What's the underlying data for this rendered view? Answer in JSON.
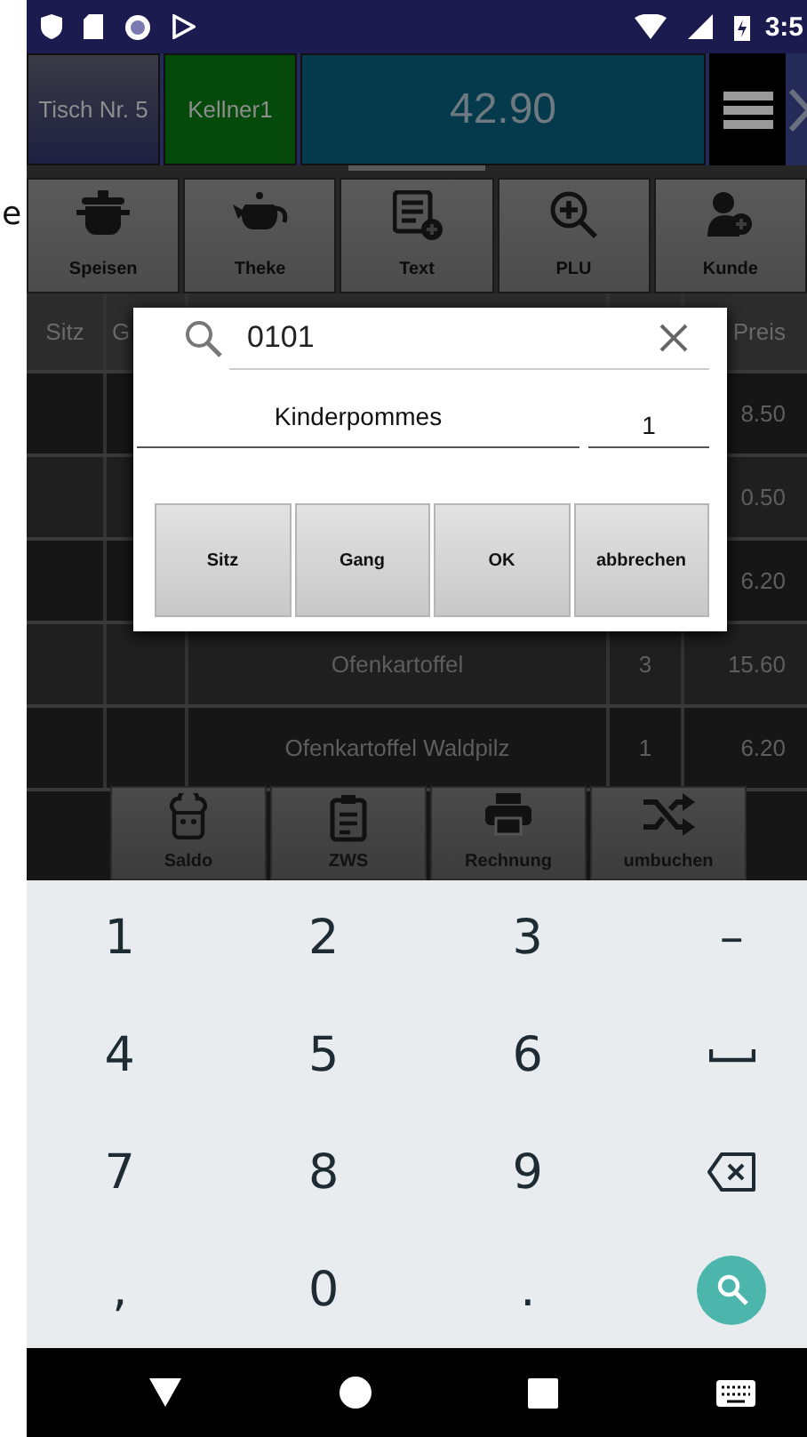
{
  "edge_text": "e",
  "status_bar": {
    "time": "3:5"
  },
  "top_bar": {
    "table": "Tisch Nr. 5",
    "waiter": "Kellner1",
    "total": "42.90"
  },
  "toolbar": [
    "Speisen",
    "Theke",
    "Text",
    "PLU",
    "Kunde"
  ],
  "table": {
    "header": {
      "seat": "Sitz",
      "column_2": "G",
      "price": "Preis"
    },
    "rows": [
      {
        "price": "8.50"
      },
      {
        "price": "0.50"
      },
      {
        "price": "6.20"
      },
      {
        "name": "Ofenkartoffel",
        "qty": "3",
        "price": "15.60"
      },
      {
        "name": "Ofenkartoffel Waldpilz",
        "qty": "1",
        "price": "6.20"
      }
    ]
  },
  "dialog": {
    "search": "0101",
    "item": "Kinderpommes",
    "quantity": "1",
    "buttons": [
      "Sitz",
      "Gang",
      "OK",
      "abbrechen"
    ]
  },
  "bottom_actions": [
    "Saldo",
    "ZWS",
    "Rechnung",
    "umbuchen"
  ],
  "keyboard": [
    {
      "kind": "char",
      "label": "1"
    },
    {
      "kind": "char",
      "label": "2"
    },
    {
      "kind": "char",
      "label": "3"
    },
    {
      "kind": "char",
      "label": "–"
    },
    {
      "kind": "char",
      "label": "4"
    },
    {
      "kind": "char",
      "label": "5"
    },
    {
      "kind": "char",
      "label": "6"
    },
    {
      "kind": "space"
    },
    {
      "kind": "char",
      "label": "7"
    },
    {
      "kind": "char",
      "label": "8"
    },
    {
      "kind": "char",
      "label": "9"
    },
    {
      "kind": "backspace"
    },
    {
      "kind": "char",
      "label": ","
    },
    {
      "kind": "char",
      "label": "0"
    },
    {
      "kind": "char",
      "label": "."
    },
    {
      "kind": "search"
    }
  ]
}
